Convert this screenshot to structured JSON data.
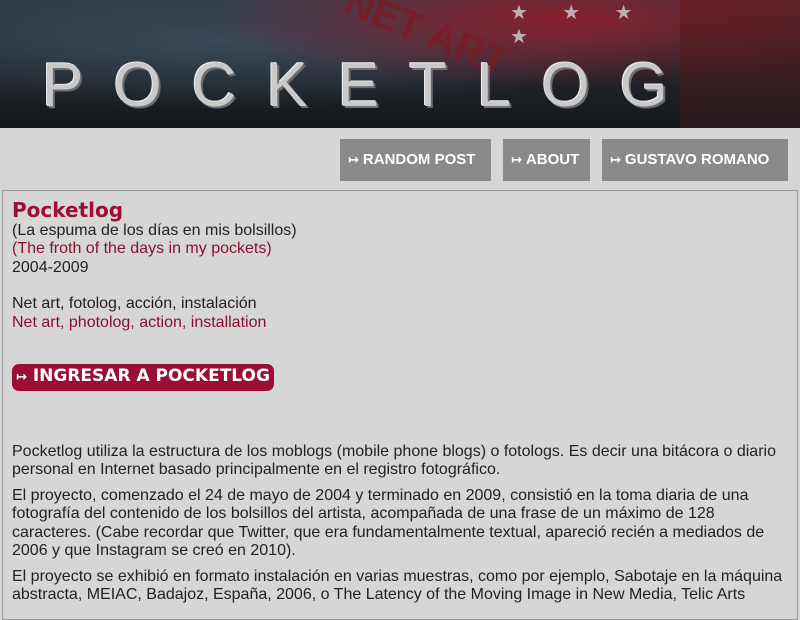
{
  "banner": {
    "logo_text": "POCKETLOG",
    "background_word": "NET ART",
    "stars": "★ ★ ★ ★"
  },
  "nav": {
    "arrow": "↦",
    "items": [
      {
        "label": "RANDOM POST"
      },
      {
        "label": "ABOUT"
      },
      {
        "label": "GUSTAVO ROMANO"
      }
    ]
  },
  "main": {
    "title": "Pocketlog",
    "subtitle_es": "(La espuma de los días en mis bolsillos)",
    "subtitle_en": "(The froth of the days in my pockets)",
    "years": "2004-2009",
    "tags_es": "Net art, fotolog, acción, instalación",
    "tags_en": "Net art, photolog, action, installation",
    "enter_button": "INGRESAR A POCKETLOG",
    "paragraphs": [
      "Pocketlog utiliza la estructura de los moblogs (mobile phone blogs) o fotologs. Es decir una bitácora o diario personal en Internet basado principalmente en el registro fotográfico.",
      "El proyecto, comenzado el 24 de mayo de 2004 y terminado en 2009, consistió en la toma diaria de una fotografía del contenido de los bolsillos del artista, acompañada de una frase de un máximo de 128 caracteres. (Cabe recordar que Twitter, que era fundamentalmente textual, apareció recién a mediados de 2006 y que Instagram se creó en 2010).",
      "El proyecto se exhibió en formato instalación en varias muestras, como por ejemplo, Sabotaje en la máquina abstracta, MEIAC, Badajoz, España, 2006, o The Latency of the Moving Image in New Media, Telic Arts"
    ]
  },
  "colors": {
    "accent": "#9b0f36",
    "nav_button": "#8a8a8a",
    "page_bg": "#d6d6d6"
  }
}
